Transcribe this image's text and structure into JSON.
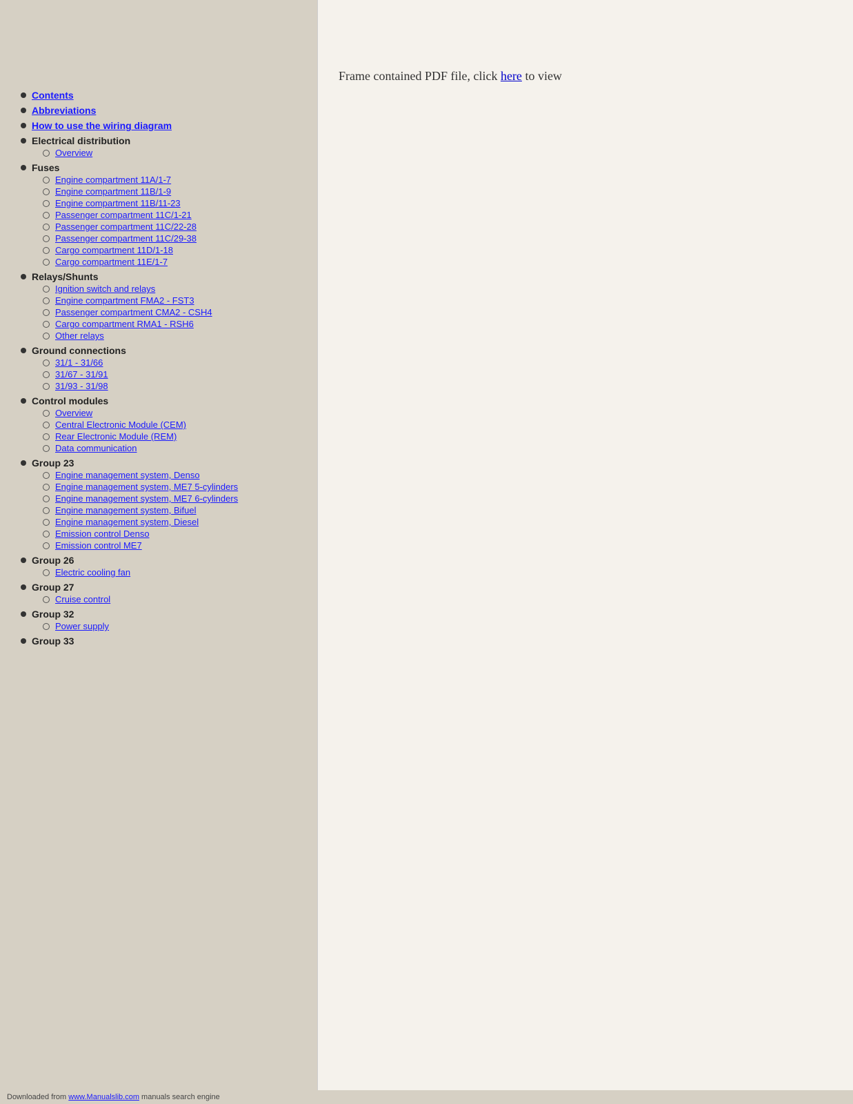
{
  "pdf_notice": {
    "text_before": "Frame contained PDF file, click ",
    "link_text": "here",
    "link_href": "#",
    "text_after": " to view"
  },
  "nav": {
    "items": [
      {
        "label": "Contents",
        "link": true,
        "href": "#"
      },
      {
        "label": "Abbreviations",
        "link": true,
        "href": "#"
      },
      {
        "label": "How to use the wiring diagram",
        "link": true,
        "href": "#"
      },
      {
        "label": "Electrical distribution",
        "link": false,
        "children": [
          {
            "label": "Overview",
            "href": "#"
          }
        ]
      },
      {
        "label": "Fuses",
        "link": false,
        "children": [
          {
            "label": "Engine compartment 11A/1-7",
            "href": "#"
          },
          {
            "label": "Engine compartment 11B/1-9",
            "href": "#"
          },
          {
            "label": "Engine compartment 11B/11-23",
            "href": "#"
          },
          {
            "label": "Passenger compartment 11C/1-21",
            "href": "#"
          },
          {
            "label": "Passenger compartment 11C/22-28",
            "href": "#"
          },
          {
            "label": "Passenger compartment 11C/29-38",
            "href": "#"
          },
          {
            "label": "Cargo compartment 11D/1-18",
            "href": "#"
          },
          {
            "label": "Cargo compartment 11E/1-7",
            "href": "#"
          }
        ]
      },
      {
        "label": "Relays/Shunts",
        "link": false,
        "children": [
          {
            "label": "Ignition switch and relays",
            "href": "#"
          },
          {
            "label": "Engine compartment FMA2 - FST3",
            "href": "#"
          },
          {
            "label": "Passenger compartment CMA2 - CSH4",
            "href": "#"
          },
          {
            "label": "Cargo compartment RMA1 - RSH6",
            "href": "#"
          },
          {
            "label": "Other relays",
            "href": "#"
          }
        ]
      },
      {
        "label": "Ground connections",
        "link": false,
        "children": [
          {
            "label": "31/1 - 31/66",
            "href": "#"
          },
          {
            "label": "31/67 - 31/91",
            "href": "#"
          },
          {
            "label": "31/93 - 31/98",
            "href": "#"
          }
        ]
      },
      {
        "label": "Control modules",
        "link": false,
        "children": [
          {
            "label": "Overview",
            "href": "#"
          },
          {
            "label": "Central Electronic Module (CEM)",
            "href": "#"
          },
          {
            "label": "Rear Electronic Module (REM)",
            "href": "#"
          },
          {
            "label": "Data communication",
            "href": "#"
          }
        ]
      },
      {
        "label": "Group 23",
        "link": false,
        "children": [
          {
            "label": "Engine management system, Denso",
            "href": "#"
          },
          {
            "label": "Engine management system, ME7 5-cylinders",
            "href": "#"
          },
          {
            "label": "Engine management system, ME7 6-cylinders",
            "href": "#"
          },
          {
            "label": "Engine management system, Bifuel",
            "href": "#"
          },
          {
            "label": "Engine management system, Diesel",
            "href": "#"
          },
          {
            "label": "Emission control Denso",
            "href": "#"
          },
          {
            "label": "Emission control ME7",
            "href": "#"
          }
        ]
      },
      {
        "label": "Group 26",
        "link": false,
        "children": [
          {
            "label": "Electric cooling fan",
            "href": "#"
          }
        ]
      },
      {
        "label": "Group 27",
        "link": false,
        "children": [
          {
            "label": "Cruise control",
            "href": "#"
          }
        ]
      },
      {
        "label": "Group 32",
        "link": false,
        "children": [
          {
            "label": "Power supply",
            "href": "#"
          }
        ]
      },
      {
        "label": "Group 33",
        "link": false,
        "children": []
      }
    ]
  },
  "footer": {
    "text": "Downloaded from ",
    "link_text": "www.Manualslib.com",
    "link_href": "#",
    "text_after": " manuals search engine"
  }
}
